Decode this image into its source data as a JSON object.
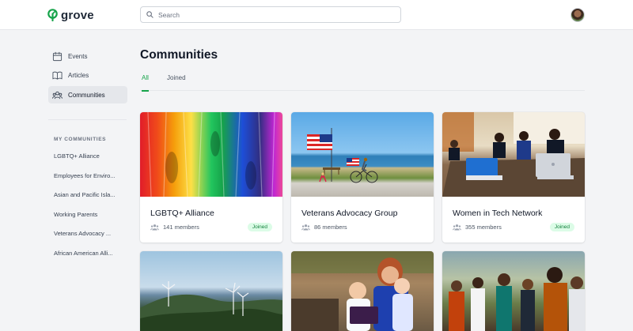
{
  "app": {
    "name": "grove"
  },
  "search": {
    "placeholder": "Search"
  },
  "sidebar": {
    "items": [
      {
        "label": "Events",
        "icon": "calendar-icon"
      },
      {
        "label": "Articles",
        "icon": "book-open-icon"
      },
      {
        "label": "Communities",
        "icon": "users-icon",
        "active": true
      }
    ],
    "my_communities_header": "MY COMMUNITIES",
    "my_communities": [
      "LGBTQ+ Alliance",
      "Employees for Enviro...",
      "Asian and Pacific Isla...",
      "Working Parents",
      "Veterans Advocacy ...",
      "African American Alli..."
    ]
  },
  "main": {
    "title": "Communities",
    "tabs": [
      {
        "label": "All",
        "active": true
      },
      {
        "label": "Joined",
        "active": false
      }
    ],
    "cards": [
      {
        "title": "LGBTQ+ Alliance",
        "members": "141 members",
        "badge": "Joined"
      },
      {
        "title": "Veterans Advocacy Group",
        "members": "86 members",
        "badge": ""
      },
      {
        "title": "Women in Tech Network",
        "members": "355 members",
        "badge": "Joined"
      },
      {
        "title": "",
        "members": "",
        "badge": ""
      },
      {
        "title": "",
        "members": "",
        "badge": ""
      },
      {
        "title": "",
        "members": "",
        "badge": ""
      }
    ]
  },
  "colors": {
    "accent": "#16a34a",
    "badge_bg": "#dcfce7",
    "badge_text": "#15803d",
    "page_bg": "#f3f4f6"
  }
}
